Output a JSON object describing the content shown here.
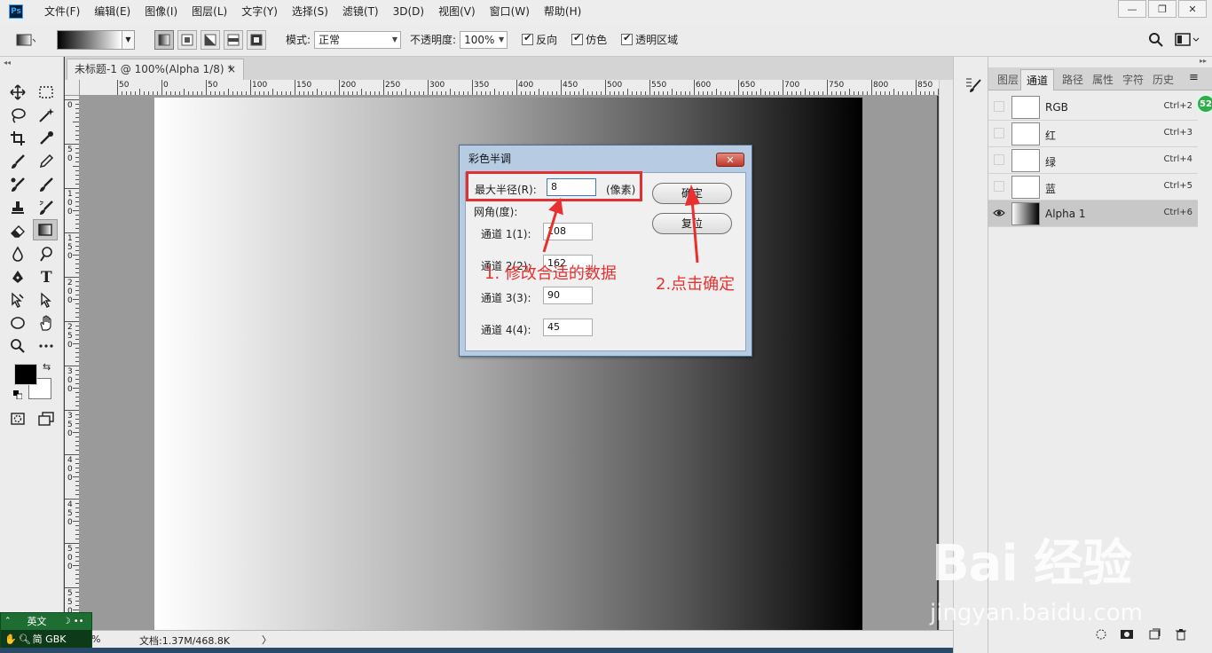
{
  "app": {
    "logo_text": "Ps"
  },
  "menu": [
    "文件(F)",
    "编辑(E)",
    "图像(I)",
    "图层(L)",
    "文字(Y)",
    "选择(S)",
    "滤镜(T)",
    "3D(D)",
    "视图(V)",
    "窗口(W)",
    "帮助(H)"
  ],
  "options_bar": {
    "mode_label": "模式:",
    "mode_value": "正常",
    "opacity_label": "不透明度:",
    "opacity_value": "100%",
    "reverse_label": "反向",
    "dither_label": "仿色",
    "transparency_label": "透明区域"
  },
  "document_tab": {
    "title": "未标题-1 @ 100%(Alpha 1/8) *",
    "close": "×"
  },
  "ruler": {
    "h_labels": [
      "50",
      "0",
      "50",
      "100",
      "150",
      "200",
      "250",
      "300",
      "350",
      "400",
      "450",
      "500",
      "550",
      "600",
      "650",
      "700",
      "750",
      "800",
      "850"
    ],
    "v_labels": [
      "0",
      "5 0",
      "1 0 0",
      "1 5 0",
      "2 0 0",
      "2 5 0",
      "3 0 0",
      "3 5 0",
      "4 0 0",
      "4 5 0",
      "5 0 0",
      "5 5 0"
    ]
  },
  "status_bar": {
    "zoom": "%",
    "doc_info": "文档:1.37M/468.8K",
    "arrow": "〉"
  },
  "ime": {
    "mode": "英文",
    "row2": "简 GBK"
  },
  "panels": {
    "tabs": [
      "图层",
      "通道",
      "路径",
      "属性",
      "字符",
      "历史"
    ],
    "active_tab": "通道",
    "channels": [
      {
        "name": "RGB",
        "shortcut": "Ctrl+2",
        "visible": false,
        "selected": false
      },
      {
        "name": "红",
        "shortcut": "Ctrl+3",
        "visible": false,
        "selected": false
      },
      {
        "name": "绿",
        "shortcut": "Ctrl+4",
        "visible": false,
        "selected": false
      },
      {
        "name": "蓝",
        "shortcut": "Ctrl+5",
        "visible": false,
        "selected": false
      },
      {
        "name": "Alpha 1",
        "shortcut": "Ctrl+6",
        "visible": true,
        "selected": true
      }
    ],
    "badge": "52"
  },
  "dialog": {
    "title": "彩色半调",
    "close": "✕",
    "max_radius_label": "最大半径(R):",
    "max_radius_value": "8",
    "unit": "(像素)",
    "screen_angle_label": "网角(度):",
    "channel1_label": "通道 1(1):",
    "channel1_value": "108",
    "channel2_label": "通道 2(2):",
    "channel2_value": "162",
    "channel3_label": "通道 3(3):",
    "channel3_value": "90",
    "channel4_label": "通道 4(4):",
    "channel4_value": "45",
    "ok_label": "确定",
    "reset_label": "复位"
  },
  "annotations": {
    "step1": "1. 修改合适的数据",
    "step2": "2.点击确定",
    "color": "#e83030"
  },
  "watermark": {
    "logo": "Bai 经验",
    "url": "jingyan.baidu.com"
  }
}
